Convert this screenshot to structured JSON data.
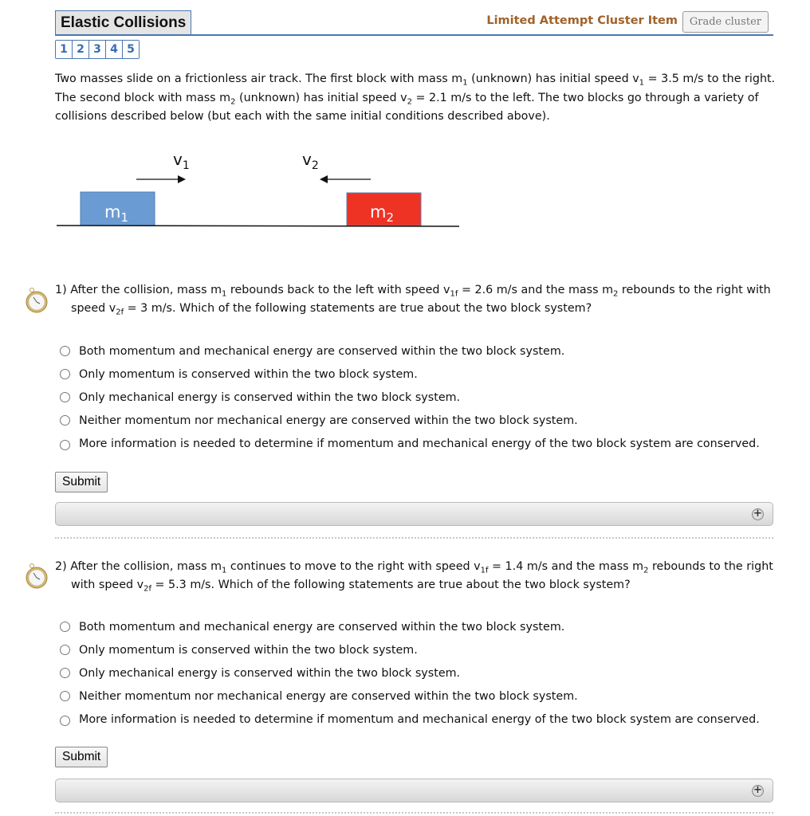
{
  "header": {
    "title": "Elastic Collisions",
    "cluster_label": "Limited Attempt Cluster Item",
    "grade_button": "Grade cluster",
    "accent_color": "#4a78b0",
    "cluster_label_color": "#a0622a"
  },
  "parts": [
    "1",
    "2",
    "3",
    "4",
    "5"
  ],
  "intro": {
    "t1": "Two masses slide on a frictionless air track. The first block with mass m",
    "s1": "1",
    "t2": " (unknown) has initial speed v",
    "s2": "1",
    "t3": " = 3.5 m/s to the right. The second block with mass m",
    "s3": "2",
    "t4": " (unknown) has initial speed v",
    "s4": "2",
    "t5": " = 2.1 m/s to the left. The two blocks go through a variety of collisions described below (but each with the same initial conditions described above)."
  },
  "diagram": {
    "v1_label": "v",
    "v1_sub": "1",
    "v2_label": "v",
    "v2_sub": "2",
    "m1_label": "m",
    "m1_sub": "1",
    "m2_label": "m",
    "m2_sub": "2",
    "m1_color": "#6a9bd2",
    "m2_color": "#ee3224"
  },
  "questions": [
    {
      "number": "1)",
      "t1": " After the collision, mass m",
      "s1": "1",
      "t2": " rebounds back to the left with speed v",
      "s2": "1f",
      "t3": " = 2.6 m/s and the mass m",
      "s3": "2",
      "t4": " rebounds to the right with speed v",
      "s4": "2f",
      "t5": " = 3 m/s. Which of the following statements are true about the two block system?",
      "options": [
        "Both momentum and mechanical energy are conserved within the two block system.",
        "Only momentum is conserved within the two block system.",
        "Only mechanical energy is conserved within the two block system.",
        "Neither momentum nor mechanical energy are conserved within the two block system.",
        "More information is needed to determine if momentum and mechanical energy of the two block system are conserved."
      ],
      "submit": "Submit"
    },
    {
      "number": "2)",
      "t1": " After the collision, mass m",
      "s1": "1",
      "t2": " continues to move to the right with speed v",
      "s2": "1f",
      "t3": " = 1.4 m/s and the mass m",
      "s3": "2",
      "t4": " rebounds to the right with speed v",
      "s4": "2f",
      "t5": " = 5.3 m/s. Which of the following statements are true about the two block system?",
      "options": [
        "Both momentum and mechanical energy are conserved within the two block system.",
        "Only momentum is conserved within the two block system.",
        "Only mechanical energy is conserved within the two block system.",
        "Neither momentum nor mechanical energy are conserved within the two block system.",
        "More information is needed to determine if momentum and mechanical energy of the two block system are conserved."
      ],
      "submit": "Submit"
    }
  ],
  "hint_expand_icon": "plus-circle-icon"
}
